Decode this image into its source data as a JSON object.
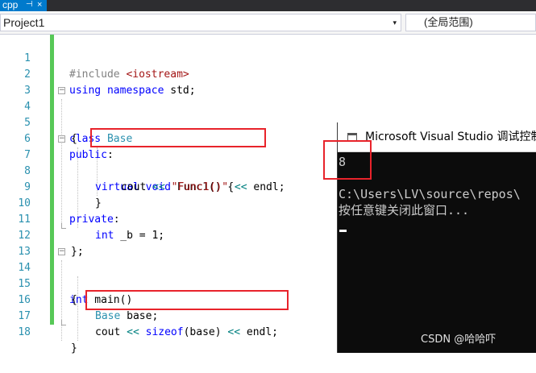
{
  "tab": {
    "label": "cpp",
    "pin": "⊣",
    "close": "×"
  },
  "navbar": {
    "project": "Project1",
    "dropdown_glyph": "▾",
    "scope": "(全局范围)"
  },
  "editor": {
    "line_numbers": [
      "1",
      "2",
      "3",
      "4",
      "5",
      "6",
      "7",
      "8",
      "9",
      "10",
      "11",
      "12",
      "13",
      "14",
      "15",
      "16",
      "17",
      "18"
    ],
    "code": {
      "l1_pp": "#include ",
      "l1_inc": "<iostream>",
      "l2_kw1": "using",
      "l2_kw2": "namespace",
      "l2_rest": " std;",
      "l4_kw": "class",
      "l4_ty": "Base",
      "l5": "{",
      "l6_kw": "public",
      "l6_rest": ":",
      "l7_kw1": "virtual",
      "l7_kw2": "void",
      "l7_rest": " Func1() {",
      "l8_a": "cout ",
      "l8_op1": "<<",
      "l8_str": "\"Func1()\"",
      "l8_op2": "<<",
      "l8_b": " endl;",
      "l9": "}",
      "l10_kw": "private",
      "l10_rest": ":",
      "l11_kw": "int",
      "l11_rest": " _b = 1;",
      "l12": "};",
      "l14_kw": "int",
      "l14_rest": " main()",
      "l15": "{",
      "l16_ty": "Base",
      "l16_rest": " base;",
      "l17_a": "cout ",
      "l17_op1": "<<",
      "l17_kw": "sizeof",
      "l17_b": "(base) ",
      "l17_op2": "<<",
      "l17_c": " endl;",
      "l18": "}"
    },
    "fold_glyph": "−"
  },
  "console": {
    "title": "Microsoft Visual Studio 调试控制台",
    "lines": [
      "8",
      "",
      "C:\\Users\\LV\\source\\repos\\",
      "按任意键关闭此窗口..."
    ]
  },
  "watermark": "CSDN @哈哈吓",
  "colors": {
    "highlight_box": "#e8232b",
    "keyword": "#0000ff",
    "type": "#2b91af",
    "string": "#a31515"
  }
}
